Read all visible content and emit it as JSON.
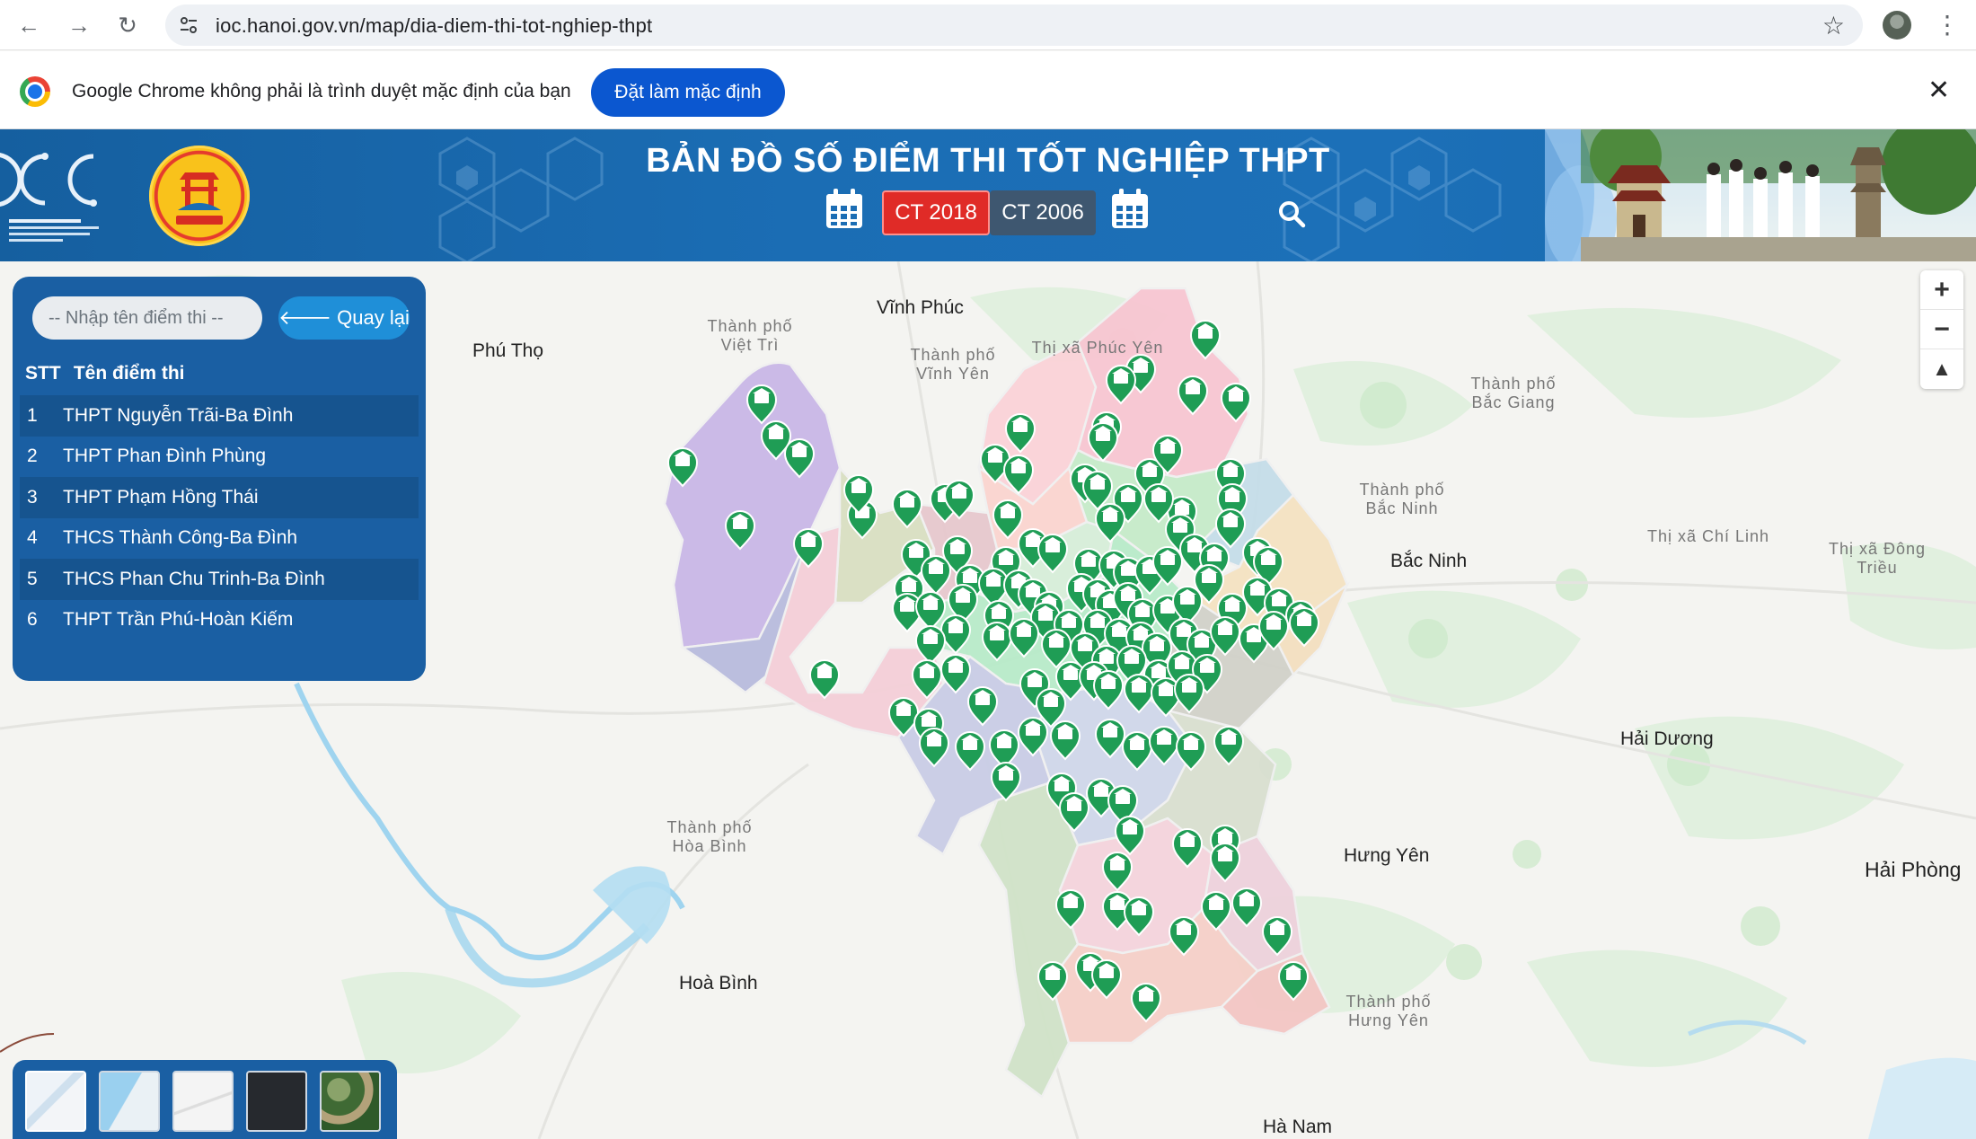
{
  "browser": {
    "url": "ioc.hanoi.gov.vn/map/dia-diem-thi-tot-nghiep-thpt"
  },
  "infobar": {
    "message": "Google Chrome không phải là trình duyệt mặc định của bạn",
    "button_label": "Đặt làm mặc định"
  },
  "header": {
    "title": "BẢN ĐỒ SỐ ĐIỂM THI TỐT NGHIỆP THPT",
    "tab_ct2018": "CT 2018",
    "tab_ct2006": "CT 2006"
  },
  "panel": {
    "search_placeholder": "-- Nhập tên điểm thi --",
    "back_label": "Quay lại",
    "col_stt": "STT",
    "col_name": "Tên điểm thi",
    "items": [
      {
        "stt": "1",
        "name": "THPT Nguyễn Trãi-Ba Đình"
      },
      {
        "stt": "2",
        "name": "THPT Phan Đình Phùng"
      },
      {
        "stt": "3",
        "name": "THPT Phạm Hồng Thái"
      },
      {
        "stt": "4",
        "name": "THCS Thành Công-Ba Đình"
      },
      {
        "stt": "5",
        "name": "THCS Phan Chu Trinh-Ba Đình"
      },
      {
        "stt": "6",
        "name": "THPT Trần Phú-Hoàn Kiếm"
      }
    ]
  },
  "map_labels": {
    "vinh_phuc": "Vĩnh Phúc",
    "phu_tho": "Phú Thọ",
    "viet_tri": "Thành phố Việt Trì",
    "vinh_yen": "Thành phố Vĩnh Yên",
    "phuc_yen": "Thị xã Phúc Yên",
    "bac_giang": "Thành phố Bắc Giang",
    "tp_bac_ninh": "Thành phố Bắc Ninh",
    "bac_ninh": "Bắc Ninh",
    "chi_linh": "Thị xã Chí Linh",
    "dong_trieu": "Thị xã Đông Triều",
    "hai_duong": "Hải Dương",
    "hung_yen": "Hưng Yên",
    "hai_phong": "Hải Phòng",
    "tp_hoa_binh": "Thành phố Hòa Bình",
    "hoa_binh": "Hoà Bình",
    "tp_hung_yen": "Thành phố Hưng Yên",
    "ha_nam": "Hà Nam"
  },
  "colors": {
    "header_blue": "#1b6db4",
    "active_tab": "#e02b27",
    "inactive_tab": "#3e5770",
    "panel_blue": "#1a5fa3",
    "marker_green": "#1f9d55"
  },
  "icons": {
    "calendar": "calendar-icon",
    "search": "search-icon",
    "marker": "school-marker-icon",
    "zoom_in": "plus-icon",
    "zoom_out": "minus-icon",
    "compass": "north-arrow-icon"
  }
}
